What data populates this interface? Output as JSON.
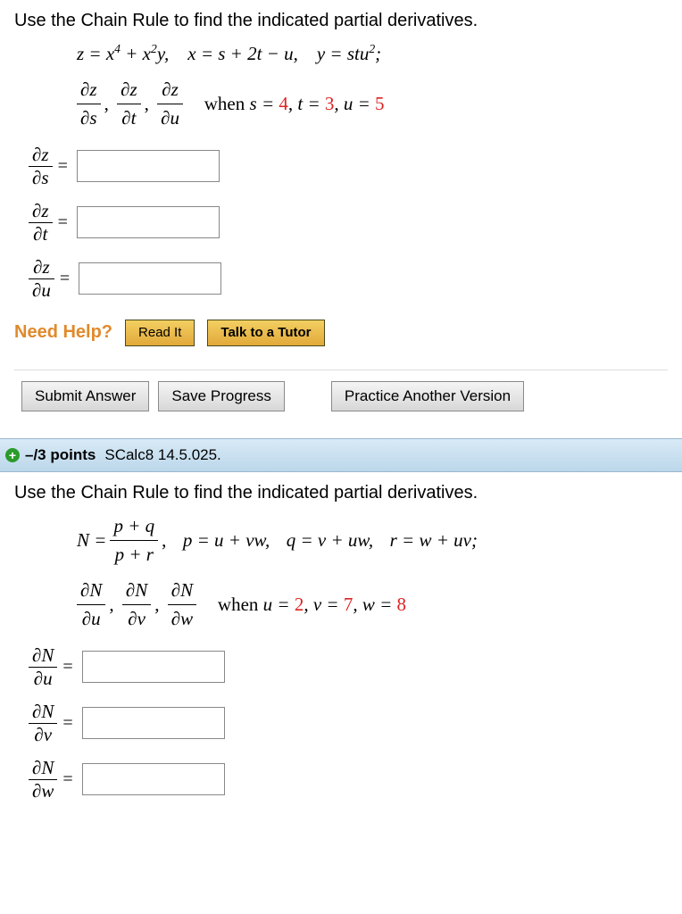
{
  "q1": {
    "prompt": "Use the Chain Rule to find the indicated partial derivatives.",
    "line1_a": "z = x",
    "line1_a_exp1": "4",
    "line1_a_mid": " + x",
    "line1_a_exp2": "2",
    "line1_a_end": "y,",
    "line1_b": "x = s + 2t − u,",
    "line1_c_pre": "y = stu",
    "line1_c_exp": "2",
    "line1_c_end": ";",
    "deriv1": {
      "num": "∂z",
      "den": "∂s"
    },
    "deriv2": {
      "num": "∂z",
      "den": "∂t"
    },
    "deriv3": {
      "num": "∂z",
      "den": "∂u"
    },
    "when_pre": "when ",
    "when_s_lbl": "s = ",
    "when_s": "4",
    "when_t_lbl": ", t = ",
    "when_t": "3",
    "when_u_lbl": ", u = ",
    "when_u": "5",
    "rows": [
      {
        "num": "∂z",
        "den": "∂s"
      },
      {
        "num": "∂z",
        "den": "∂t"
      },
      {
        "num": "∂z",
        "den": "∂u"
      }
    ],
    "need_help": "Need Help?",
    "read_it": "Read It",
    "talk": "Talk to a Tutor"
  },
  "actions": {
    "submit": "Submit Answer",
    "save": "Save Progress",
    "practice": "Practice Another Version"
  },
  "q2header": {
    "points": "–/3 points",
    "ref": "SCalc8 14.5.025."
  },
  "q2": {
    "prompt": "Use the Chain Rule to find the indicated partial derivatives.",
    "N_lhs": "N = ",
    "N_num": "p + q",
    "N_den": "p + r",
    "comma": ",",
    "p_eq": "p = u + vw,",
    "q_eq": "q = v + uw,",
    "r_eq": "r = w + uv;",
    "deriv1": {
      "num": "∂N",
      "den": "∂u"
    },
    "deriv2": {
      "num": "∂N",
      "den": "∂v"
    },
    "deriv3": {
      "num": "∂N",
      "den": "∂w"
    },
    "when_pre": "when ",
    "when_u_lbl": "u = ",
    "when_u": "2",
    "when_v_lbl": ", v = ",
    "when_v": "7",
    "when_w_lbl": ", w = ",
    "when_w": "8",
    "rows": [
      {
        "num": "∂N",
        "den": "∂u"
      },
      {
        "num": "∂N",
        "den": "∂v"
      },
      {
        "num": "∂N",
        "den": "∂w"
      }
    ]
  }
}
